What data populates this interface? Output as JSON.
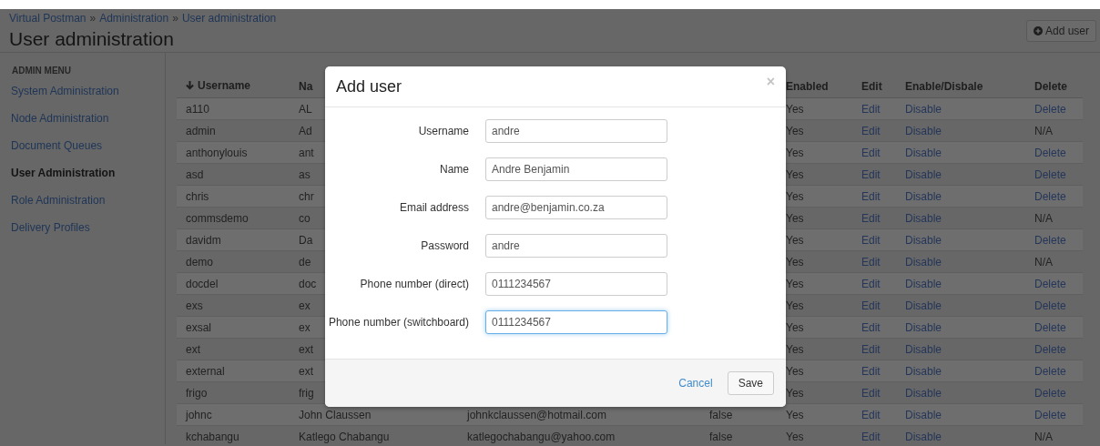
{
  "breadcrumb": [
    {
      "kind": "link",
      "label": "Virtual Postman"
    },
    {
      "kind": "separator",
      "label": "»"
    },
    {
      "kind": "link",
      "label": "Administration"
    },
    {
      "kind": "separator",
      "label": "»"
    },
    {
      "kind": "link",
      "label": "User administration"
    }
  ],
  "page_title": "User administration",
  "add_user_button": {
    "label": "Add user"
  },
  "sidebar": {
    "heading": "ADMIN MENU",
    "items": [
      {
        "label": "System Administration",
        "selected": false
      },
      {
        "label": "Node Administration",
        "selected": false
      },
      {
        "label": "Document Queues",
        "selected": false
      },
      {
        "label": "User Administration",
        "selected": true
      },
      {
        "label": "Role Administration",
        "selected": false
      },
      {
        "label": "Delivery Profiles",
        "selected": false
      }
    ]
  },
  "table": {
    "columns": [
      {
        "label": "Username",
        "sorted": true
      },
      {
        "label": "Na",
        "sorted": false
      },
      {},
      {},
      {
        "label": "Enabled",
        "sorted": false
      },
      {
        "label": "Edit",
        "sorted": false
      },
      {
        "label": "Enable/Disbale",
        "sorted": false
      },
      {
        "label": "Delete",
        "sorted": false
      }
    ],
    "rows": [
      {
        "username": "a110",
        "name": "AL",
        "enabled": "Yes",
        "edit": "Edit",
        "enable_disable": "Disable",
        "delete": {
          "kind": "link",
          "text": "Delete"
        }
      },
      {
        "username": "admin",
        "name": "Ad",
        "enabled": "Yes",
        "edit": "Edit",
        "enable_disable": "Disable",
        "delete": {
          "kind": "text",
          "text": "N/A"
        }
      },
      {
        "username": "anthonylouis",
        "name": "ant",
        "enabled": "Yes",
        "edit": "Edit",
        "enable_disable": "Disable",
        "delete": {
          "kind": "link",
          "text": "Delete"
        }
      },
      {
        "username": "asd",
        "name": "as",
        "enabled": "Yes",
        "edit": "Edit",
        "enable_disable": "Disable",
        "delete": {
          "kind": "link",
          "text": "Delete"
        }
      },
      {
        "username": "chris",
        "name": "chr",
        "enabled": "Yes",
        "edit": "Edit",
        "enable_disable": "Disable",
        "delete": {
          "kind": "link",
          "text": "Delete"
        }
      },
      {
        "username": "commsdemo",
        "name": "co",
        "enabled": "Yes",
        "edit": "Edit",
        "enable_disable": "Disable",
        "delete": {
          "kind": "text",
          "text": "N/A"
        }
      },
      {
        "username": "davidm",
        "name": "Da",
        "enabled": "Yes",
        "edit": "Edit",
        "enable_disable": "Disable",
        "delete": {
          "kind": "link",
          "text": "Delete"
        }
      },
      {
        "username": "demo",
        "name": "de",
        "enabled": "Yes",
        "edit": "Edit",
        "enable_disable": "Disable",
        "delete": {
          "kind": "text",
          "text": "N/A"
        }
      },
      {
        "username": "docdel",
        "name": "doc",
        "enabled": "Yes",
        "edit": "Edit",
        "enable_disable": "Disable",
        "delete": {
          "kind": "link",
          "text": "Delete"
        }
      },
      {
        "username": "exs",
        "name": "ex",
        "enabled": "Yes",
        "edit": "Edit",
        "enable_disable": "Disable",
        "delete": {
          "kind": "link",
          "text": "Delete"
        }
      },
      {
        "username": "exsal",
        "name": "ex",
        "enabled": "Yes",
        "edit": "Edit",
        "enable_disable": "Disable",
        "delete": {
          "kind": "link",
          "text": "Delete"
        }
      },
      {
        "username": "ext",
        "name": "ext",
        "enabled": "Yes",
        "edit": "Edit",
        "enable_disable": "Disable",
        "delete": {
          "kind": "link",
          "text": "Delete"
        }
      },
      {
        "username": "external",
        "name": "ext",
        "enabled": "Yes",
        "edit": "Edit",
        "enable_disable": "Disable",
        "delete": {
          "kind": "link",
          "text": "Delete"
        }
      },
      {
        "username": "frigo",
        "name": "frig",
        "enabled": "Yes",
        "edit": "Edit",
        "enable_disable": "Disable",
        "delete": {
          "kind": "link",
          "text": "Delete"
        }
      },
      {
        "username": "johnc",
        "name": "John Claussen",
        "email": "johnkclaussen@hotmail.com",
        "column_4": "false",
        "enabled": "Yes",
        "edit": "Edit",
        "enable_disable": "Disable",
        "delete": {
          "kind": "link",
          "text": "Delete"
        }
      },
      {
        "username": "kchabangu",
        "name": "Katlego Chabangu",
        "email": "katlegochabangu@yahoo.com",
        "column_4": "false",
        "enabled": "Yes",
        "edit": "Edit",
        "enable_disable": "Disable",
        "delete": {
          "kind": "text",
          "text": "N/A"
        }
      }
    ]
  },
  "modal": {
    "title": "Add user",
    "close": "×",
    "fields": [
      {
        "label": "Username",
        "value": "andre",
        "focused": false
      },
      {
        "label": "Name",
        "value": "Andre Benjamin",
        "focused": false
      },
      {
        "label": "Email address",
        "value": "andre@benjamin.co.za",
        "focused": false
      },
      {
        "label": "Password",
        "value": "andre",
        "focused": false
      },
      {
        "label": "Phone number (direct)",
        "value": "0111234567",
        "focused": false
      },
      {
        "label": "Phone number (switchboard)",
        "value": "0111234567",
        "focused": true
      }
    ],
    "buttons": [
      {
        "kind": "link",
        "label": "Cancel"
      },
      {
        "kind": "button",
        "label": "Save"
      }
    ]
  }
}
